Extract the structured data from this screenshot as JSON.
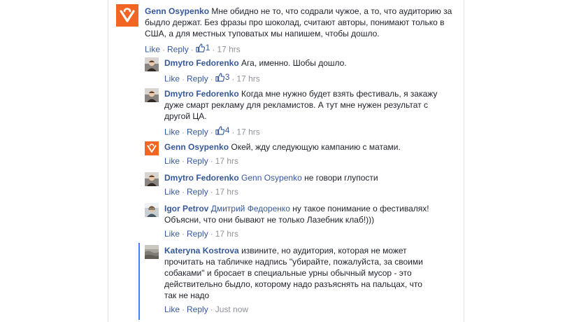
{
  "comments": [
    {
      "author": "Genn Osypenko",
      "text": "Мне обидно не то, что содрали чужое, а то, что аудиторию за быдло держат. Без фразы про шоколад, считают авторы, понимают только в США, а для местных туповатых мы напишем, чтобы дошло.",
      "mention": "",
      "like": "Like",
      "reply": "Reply",
      "likes": "1",
      "time": "17 hrs",
      "avatar": "brand-logo",
      "avatar_color": "#f26522"
    },
    {
      "author": "Dmytro Fedorenko",
      "text": "Ага, именно. Шобы дошло.",
      "mention": "",
      "like": "Like",
      "reply": "Reply",
      "likes": "3",
      "time": "17 hrs",
      "avatar": "user-photo"
    },
    {
      "author": "Dmytro Fedorenko",
      "text": "Когда мне нужно будет взять фестиваль, я закажу дуже смарт рекламу для рекламистов. А тут мне нужен результат с другой ЦА.",
      "mention": "",
      "like": "Like",
      "reply": "Reply",
      "likes": "4",
      "time": "17 hrs",
      "avatar": "user-photo"
    },
    {
      "author": "Genn Osypenko",
      "text": "Окей, жду следующую кампанию с матами.",
      "mention": "",
      "like": "Like",
      "reply": "Reply",
      "likes": "",
      "time": "17 hrs",
      "avatar": "brand-logo",
      "avatar_color": "#f26522"
    },
    {
      "author": "Dmytro Fedorenko",
      "text": "не говори глупости",
      "mention": "Genn Osypenko",
      "like": "Like",
      "reply": "Reply",
      "likes": "",
      "time": "17 hrs",
      "avatar": "user-photo"
    },
    {
      "author": "Igor Petrov",
      "text": "ну такое понимание о фестивалях! Объясни, что они бывают не только Лазебник клаб!)))",
      "mention": "Дмитрий Федоренко",
      "like": "Like",
      "reply": "Reply",
      "likes": "",
      "time": "17 hrs",
      "avatar": "user-photo"
    },
    {
      "author": "Kateryna Kostrova",
      "text": "извините, но аудитория, которая не может прочитать на табличке надпись \"убирайте, пожалуйста, за своими собаками\" и бросает в специальные урны обычный мусор - это действительно быдло, которому надо разъяснять на пальцах, что так не надо",
      "mention": "",
      "like": "Like",
      "reply": "Reply",
      "likes": "",
      "time": "Just now",
      "avatar": "user-photo"
    }
  ],
  "colors": {
    "link": "#365899",
    "meta": "#90949c",
    "brand": "#f26522",
    "thread_highlight": "#4080ff"
  }
}
